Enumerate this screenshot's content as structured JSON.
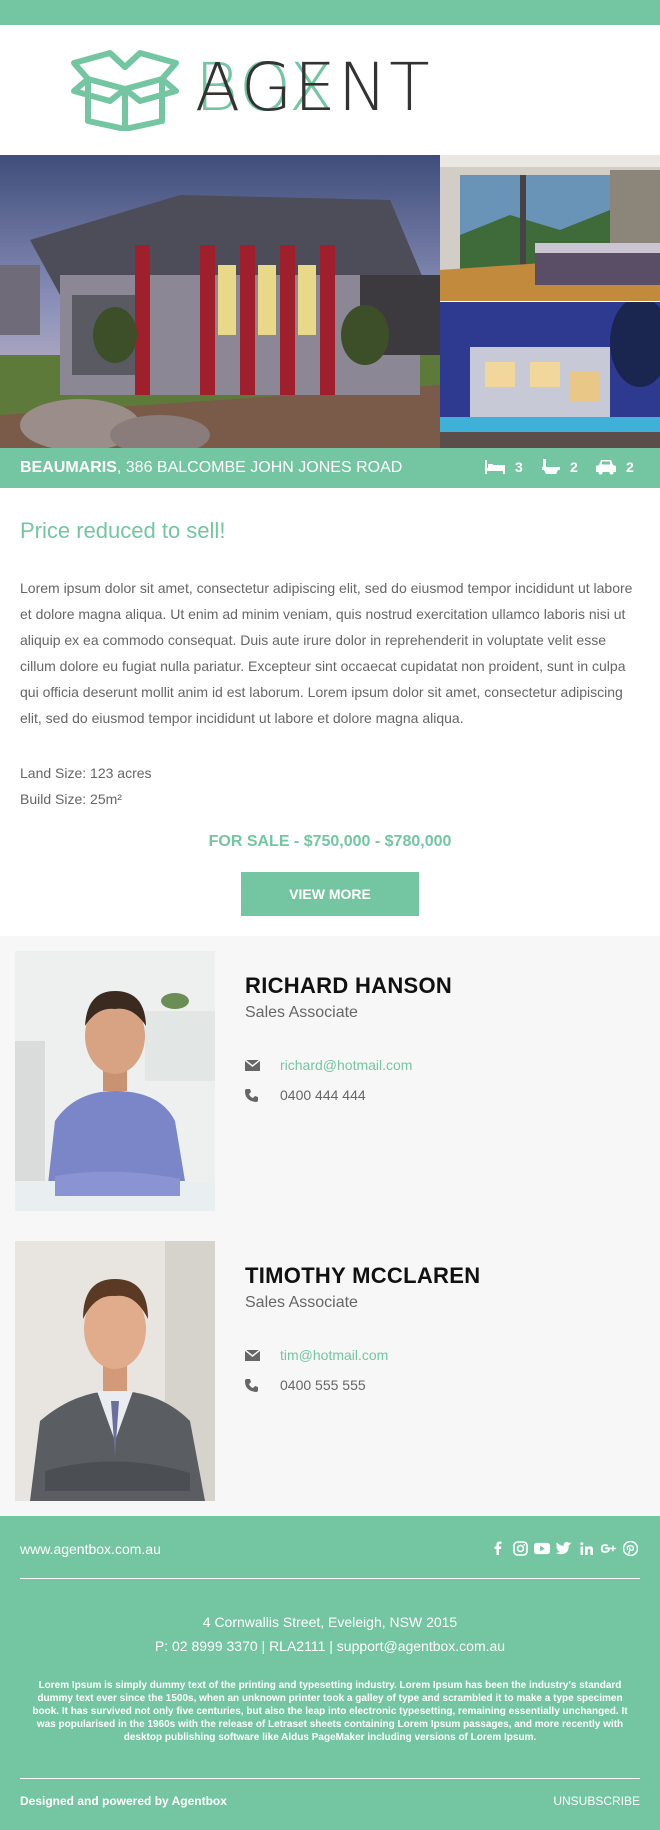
{
  "brand": {
    "name_part1": "AGENT",
    "name_part2": "BOX",
    "accent": "#74c6a3"
  },
  "listing": {
    "suburb": "BEAUMARIS",
    "street": ", 386 BALCOMBE JOHN JONES ROAD",
    "bedrooms": "3",
    "bathrooms": "2",
    "cars": "2",
    "headline": "Price reduced to sell!",
    "description": "Lorem ipsum dolor sit amet, consectetur adipiscing elit, sed do eiusmod tempor incididunt ut labore et dolore magna aliqua. Ut enim ad minim veniam, quis nostrud exercitation ullamco laboris nisi ut aliquip ex ea commodo consequat. Duis aute irure dolor in reprehenderit in voluptate velit esse cillum dolore eu fugiat nulla pariatur. Excepteur sint occaecat cupidatat non proident, sunt in culpa qui officia deserunt mollit anim id est laborum. Lorem ipsum dolor sit amet, consectetur adipiscing elit, sed do eiusmod tempor incididunt ut labore et dolore magna aliqua.",
    "land_size": "Land Size: 123 acres",
    "build_size": "Build Size: 25m²",
    "price": "FOR SALE - $750,000 - $780,000",
    "cta": "VIEW MORE"
  },
  "agents": [
    {
      "name": "RICHARD HANSON",
      "role": "Sales Associate",
      "email": "richard@hotmail.com",
      "phone": "0400 444 444"
    },
    {
      "name": "TIMOTHY MCCLAREN",
      "role": "Sales Associate",
      "email": "tim@hotmail.com",
      "phone": "0400 555 555"
    }
  ],
  "footer": {
    "website": "www.agentbox.com.au",
    "social_icons": [
      "facebook-icon",
      "instagram-icon",
      "youtube-icon",
      "twitter-icon",
      "linkedin-icon",
      "google-plus-icon",
      "pinterest-icon"
    ],
    "address": "4 Cornwallis Street, Eveleigh, NSW 2015",
    "contact": "P: 02 8999 3370 | RLA2111 | support@agentbox.com.au",
    "lorem": "Lorem Ipsum is simply dummy text of the printing and typesetting industry. Lorem Ipsum has been the industry's standard dummy text ever since the 1500s, when an unknown printer took a galley of type and scrambled it to make a type specimen book. It has survived not only five centuries, but also the leap into electronic typesetting, remaining essentially unchanged. It was popularised in the 1960s with the release of Letraset sheets containing Lorem Ipsum passages, and more recently with desktop publishing software like Aldus PageMaker including versions of Lorem Ipsum.",
    "designed_by": "Designed and powered by Agentbox",
    "unsubscribe": "UNSUBSCRIBE"
  }
}
